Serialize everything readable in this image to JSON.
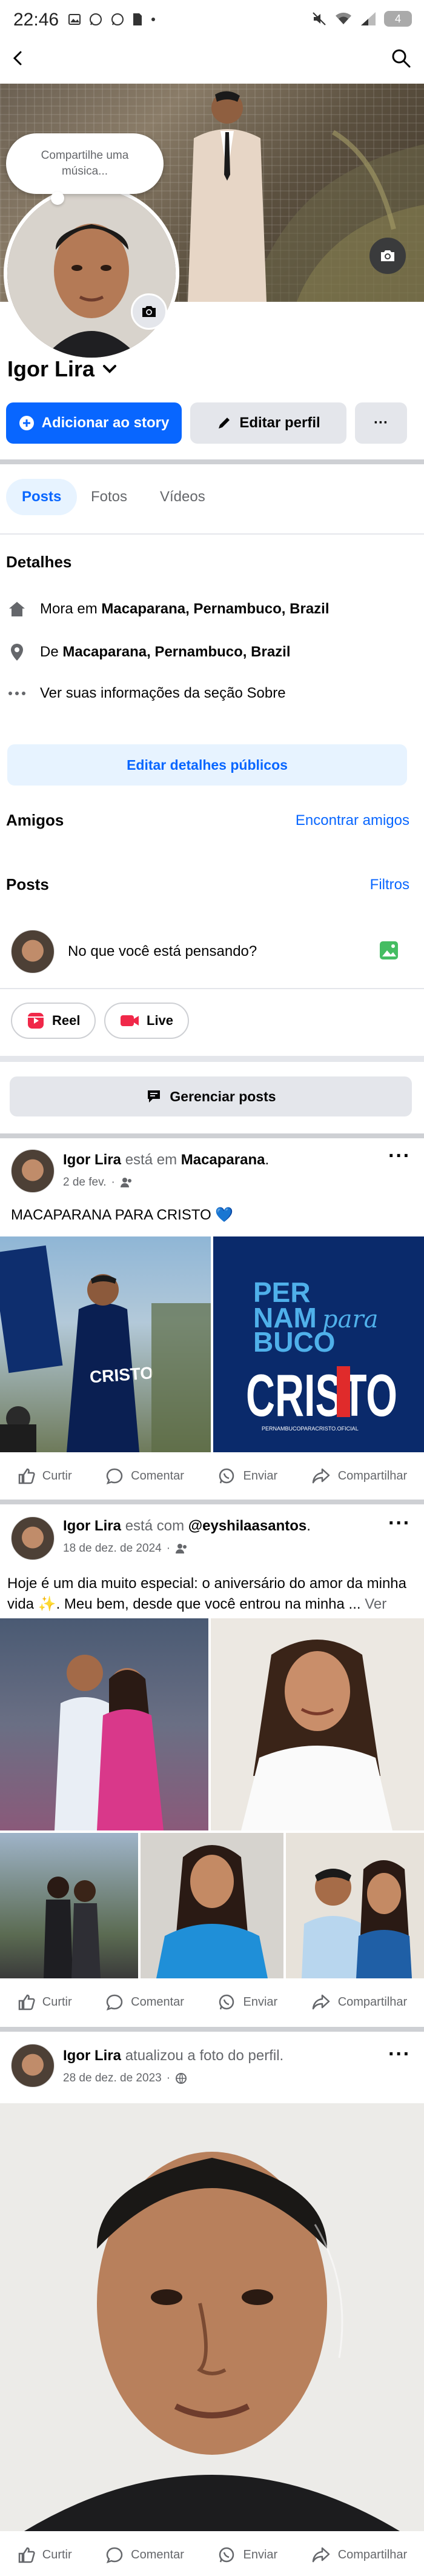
{
  "status_bar": {
    "time": "22:46",
    "battery": "4"
  },
  "profile": {
    "name": "Igor Lira",
    "music_prompt": "Compartilhe uma música...",
    "add_story_label": "Adicionar ao story",
    "edit_profile_label": "Editar perfil",
    "more_label": "···"
  },
  "tabs": [
    {
      "label": "Posts",
      "active": true
    },
    {
      "label": "Fotos",
      "active": false
    },
    {
      "label": "Vídeos",
      "active": false
    }
  ],
  "details": {
    "title": "Detalhes",
    "lives_prefix": "Mora em",
    "lives_place": "Macaparana, Pernambuco, Brazil",
    "from_prefix": "De",
    "from_place": "Macaparana, Pernambuco, Brazil",
    "about_link": "Ver suas informações da seção Sobre",
    "edit_public_details": "Editar detalhes públicos"
  },
  "friends": {
    "title": "Amigos",
    "find_friends": "Encontrar amigos"
  },
  "posts_section": {
    "title": "Posts",
    "filters": "Filtros",
    "composer_placeholder": "No que você está pensando?",
    "reel_label": "Reel",
    "live_label": "Live",
    "manage_posts": "Gerenciar posts"
  },
  "posts": [
    {
      "author": "Igor Lira",
      "action": "está em",
      "target": "Macaparana",
      "suffix": ".",
      "date": "2 de fev.",
      "text": "MACAPARANA PARA CRISTO 💙",
      "graphic": {
        "line1": "PER",
        "line2": "NAM",
        "line2_script": "para",
        "line3": "BUCO",
        "big": "CRISTO",
        "footer": "PERNAMBUCOPARACRISTO.OFICIAL"
      },
      "shirt_text": "CRISTO"
    },
    {
      "author": "Igor Lira",
      "action": "está com",
      "target": "@eyshilaasantos",
      "suffix": ".",
      "date": "18 de dez. de 2024",
      "text_line1": "Hoje é um dia muito especial: o aniversário do amor da minha",
      "text_line2": "vida ✨. Meu bem, desde que você entrou na minha ...",
      "see_more": "Ver mais"
    },
    {
      "author": "Igor Lira",
      "action": "atualizou a foto do perfil.",
      "date": "28 de dez. de 2023"
    }
  ],
  "actions": {
    "like": "Curtir",
    "comment": "Comentar",
    "send": "Enviar",
    "share": "Compartilhar"
  },
  "colors": {
    "accent": "#0866ff",
    "accent_light": "#e7f3ff",
    "secondary": "#e4e6eb",
    "muted_text": "#65676b"
  }
}
